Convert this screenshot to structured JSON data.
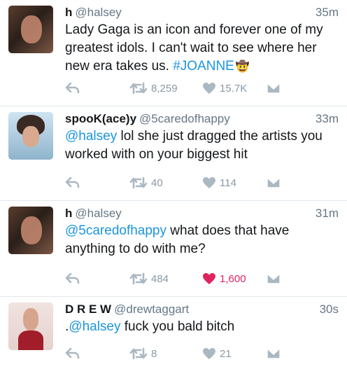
{
  "tweets": [
    {
      "avatar": "halsey-avatar",
      "name": "h",
      "handle": "@halsey",
      "time": "35m",
      "text_plain": "Lady Gaga is an icon and forever one of my greatest idols. I can't wait to see where her new era takes us.",
      "hashtag": "#JOANNE",
      "emoji": "🤠",
      "retweets": "8,259",
      "likes": "15.7K",
      "liked": false
    },
    {
      "avatar": "spook-avatar",
      "name": "spooK(ace)y",
      "handle": "@5caredofhappy",
      "time": "33m",
      "mention": "@halsey",
      "text_plain": " lol she just dragged the artists you worked with on your biggest hit",
      "retweets": "40",
      "likes": "114",
      "liked": false
    },
    {
      "avatar": "halsey-avatar",
      "name": "h",
      "handle": "@halsey",
      "time": "31m",
      "mention": "@5caredofhappy",
      "text_plain": " what does that have anything to do with me?",
      "retweets": "484",
      "likes": "1,600",
      "liked": true
    },
    {
      "avatar": "drew-avatar",
      "name": "D R E W",
      "handle": "@drewtaggart",
      "time": "30s",
      "prefix": ".",
      "mention": "@halsey",
      "text_plain": " fuck you bald bitch",
      "retweets": "8",
      "likes": "21",
      "liked": false
    }
  ],
  "icons": {
    "reply": "reply-icon",
    "retweet": "retweet-icon",
    "like": "heart-icon",
    "dm": "envelope-icon"
  },
  "colors": {
    "link": "#1b95e0",
    "muted": "#8899a6",
    "liked": "#e0245e",
    "divider": "#e1e8ed"
  }
}
